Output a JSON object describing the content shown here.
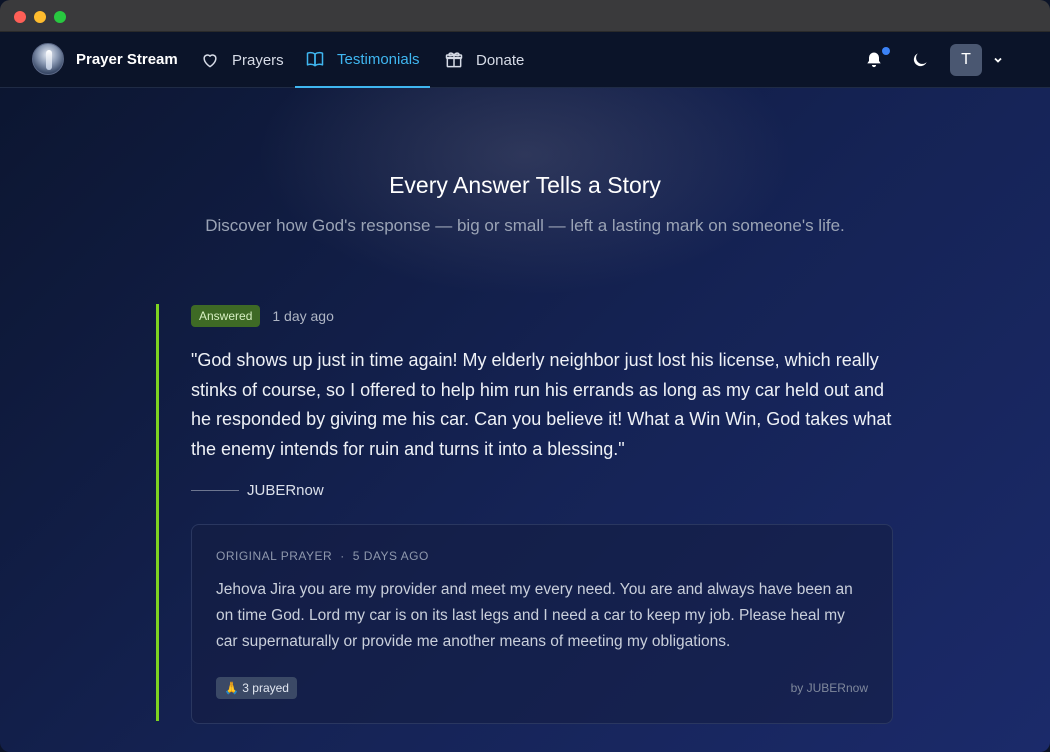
{
  "app": {
    "name": "Prayer Stream"
  },
  "nav": {
    "items": [
      {
        "label": "Prayers",
        "icon": "heart-icon"
      },
      {
        "label": "Testimonials",
        "icon": "book-icon",
        "active": true
      },
      {
        "label": "Donate",
        "icon": "gift-icon"
      }
    ]
  },
  "user": {
    "initial": "T"
  },
  "hero": {
    "title": "Every Answer Tells a Story",
    "subtitle": "Discover how God's response — big or small — left a lasting mark on someone's life."
  },
  "testimonial": {
    "status": "Answered",
    "time": "1 day ago",
    "quote": "\"God shows up just in time again! My elderly neighbor just lost his license, which really stinks of course, so I offered to help him run his errands as long as my car held out and he responded by giving me his car. Can you believe it! What a Win Win, God takes what the enemy intends for ruin and turns it into a blessing.\"",
    "author": "JUBERnow",
    "original_prayer": {
      "label": "ORIGINAL PRAYER",
      "separator": "·",
      "time": "5 DAYS AGO",
      "text": "Jehova Jira you are my provider and meet my every need. You are and always have been an on time God. Lord my car is on its last legs and I need a car to keep my job. Please heal my car supernaturally or provide me another means of meeting my obligations.",
      "prayed": "🙏 3 prayed",
      "byline": "by JUBERnow"
    }
  },
  "colors": {
    "accent": "#3fb6f0",
    "answered_bar": "#7ed321",
    "badge_bg": "#3e6a25",
    "notification_dot": "#3b82f6"
  }
}
